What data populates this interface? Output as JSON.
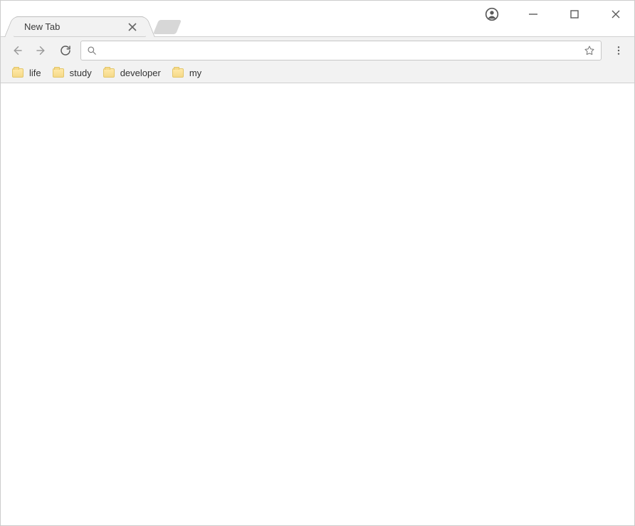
{
  "tab": {
    "title": "New Tab"
  },
  "omnibox": {
    "value": "",
    "placeholder": ""
  },
  "bookmarks": [
    {
      "label": "life"
    },
    {
      "label": "study"
    },
    {
      "label": "developer"
    },
    {
      "label": "my"
    }
  ]
}
